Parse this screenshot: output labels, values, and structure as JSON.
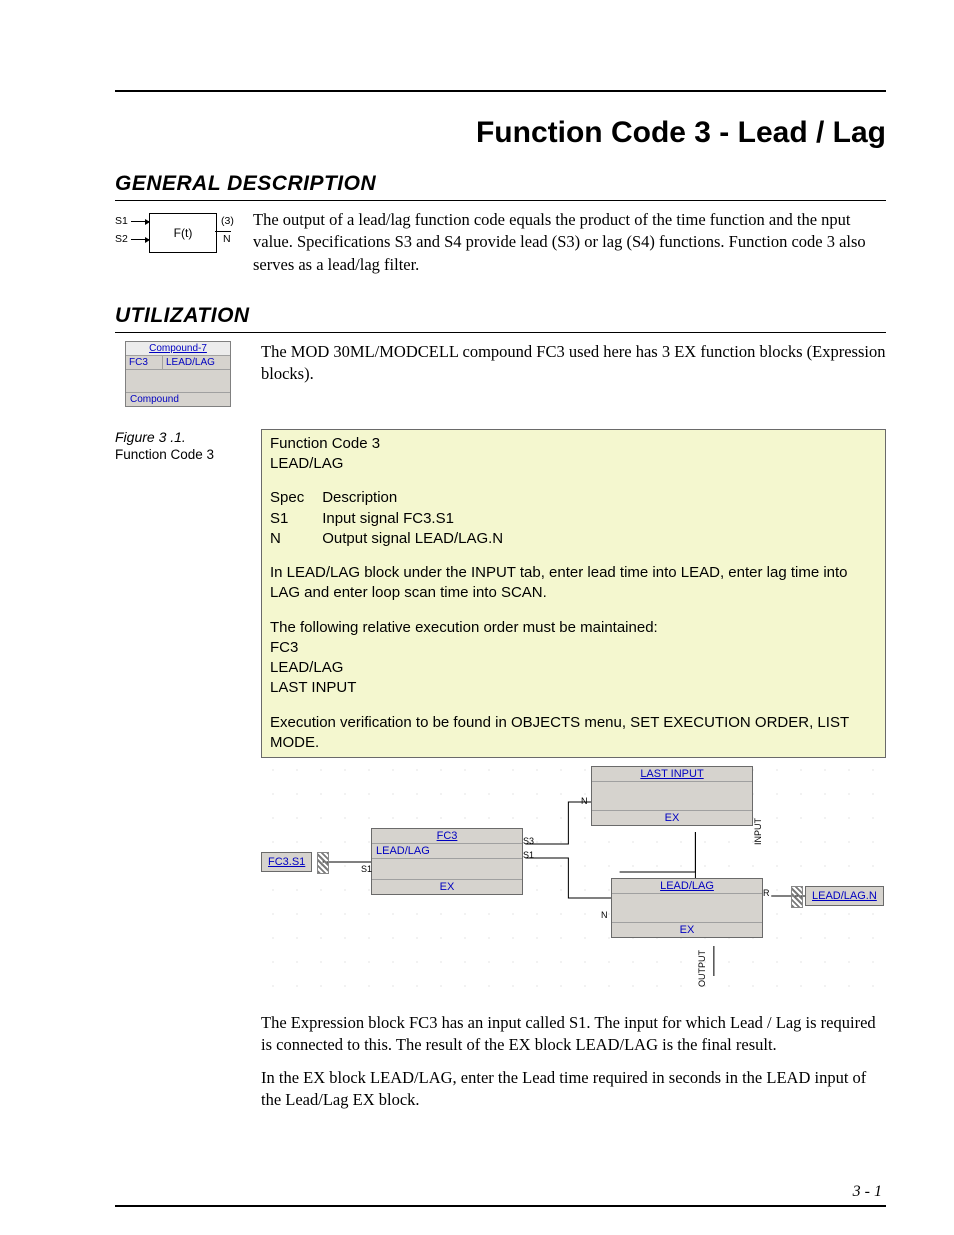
{
  "page": {
    "title": "Function Code 3 - Lead / Lag",
    "number": "3 - 1"
  },
  "sections": {
    "general": {
      "heading": "GENERAL DESCRIPTION",
      "text": "The output of a lead/lag function code equals the product of the time function and the nput value. Specifications S3 and S4 provide lead (S3) or lag (S4) functions. Function code 3 also serves as a lead/lag filter."
    },
    "utilization": {
      "heading": "UTILIZATION",
      "intro": "The MOD 30ML/MODCELL compound FC3 used here has 3 EX function blocks (Expression blocks).",
      "after_diagram_p1": "The Expression block FC3 has an input called S1. The input for which Lead / Lag is required is connected to this. The result of the EX block LEAD/LAG is the final result.",
      "after_diagram_p2": "In the EX block LEAD/LAG, enter the Lead time required in seconds in the LEAD input of the Lead/Lag EX block."
    }
  },
  "ft_icon": {
    "s1": "S1",
    "s2": "S2",
    "center": "F(t)",
    "out_top": "(3)",
    "out_bot": "N"
  },
  "compound_icon": {
    "header": "Compound-7",
    "left": "FC3",
    "right": "LEAD/LAG",
    "footer": "Compound"
  },
  "figure": {
    "label": "Figure 3 .1.",
    "caption": "Function Code 3"
  },
  "note": {
    "line1": "Function Code 3",
    "line2": "LEAD/LAG",
    "spec_hdr_a": "Spec",
    "spec_hdr_b": "Description",
    "rows": [
      {
        "a": "S1",
        "b": "Input signal FC3.S1"
      },
      {
        "a": "N",
        "b": "Output signal LEAD/LAG.N"
      }
    ],
    "p1": "In LEAD/LAG block under the INPUT tab, enter lead time into LEAD, enter lag time into LAG and enter loop scan time into SCAN.",
    "p2": "The following relative execution order must be maintained:",
    "ord": [
      "FC3",
      "LEAD/LAG",
      "LAST INPUT"
    ],
    "p3": "Execution verification to be found in OBJECTS menu, SET EXECUTION ORDER, LIST MODE."
  },
  "diagram": {
    "input_tag": "FC3.S1",
    "output_tag": "LEAD/LAG.N",
    "fc3": {
      "title": "FC3",
      "sub": "LEAD/LAG",
      "ex": "EX"
    },
    "last": {
      "title": "LAST INPUT",
      "ex": "EX"
    },
    "ll": {
      "title": "LEAD/LAG",
      "ex": "EX"
    },
    "pins": {
      "s1": "S1",
      "s3": "S3",
      "n": "N",
      "r": "R",
      "output": "OUTPUT",
      "input": "INPUT"
    }
  }
}
